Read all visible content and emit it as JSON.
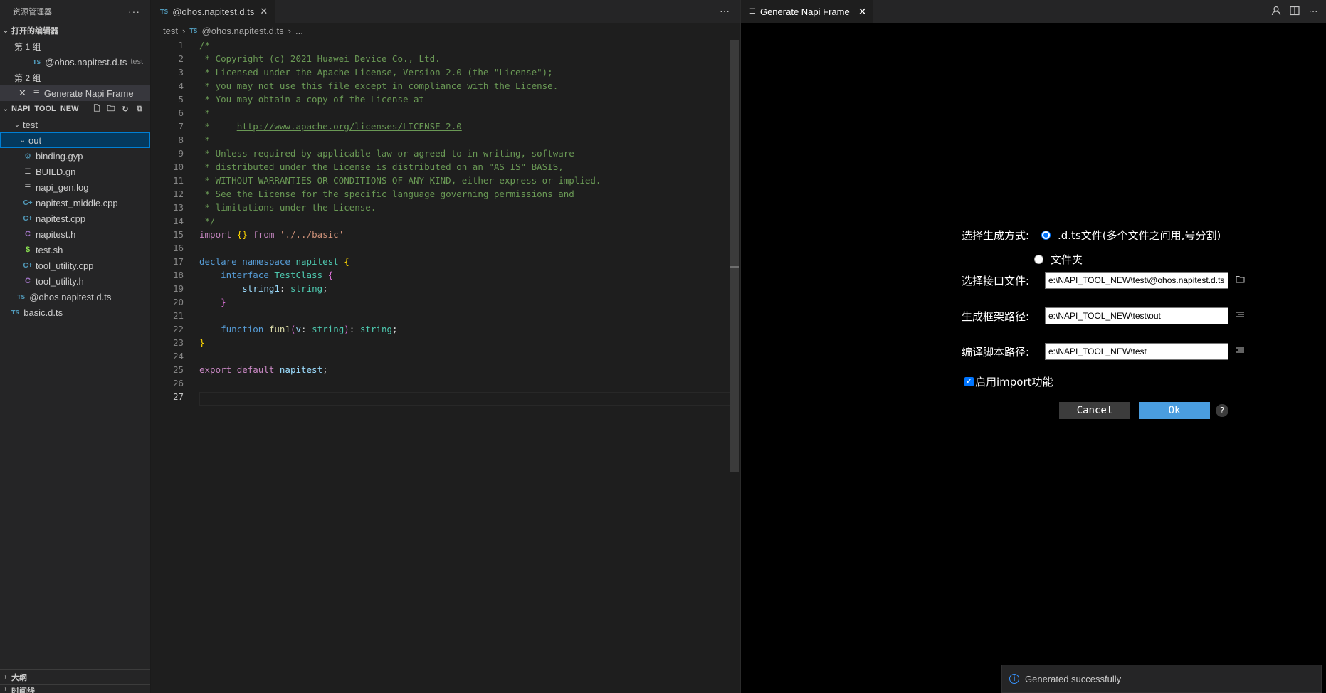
{
  "explorer": {
    "title": "资源管理器",
    "more": "···",
    "open_editors": {
      "label": "打开的编辑器",
      "group1": "第 1 组",
      "group1_file": "@ohos.napitest.d.ts",
      "group1_file_desc": "test",
      "group2": "第 2 组",
      "group2_file": "Generate Napi Frame"
    },
    "project": {
      "label": "NAPI_TOOL_NEW",
      "folder_test": "test",
      "folder_out": "out",
      "files_out": [
        {
          "name": "binding.gyp",
          "icon": "gyp-icon"
        },
        {
          "name": "BUILD.gn",
          "icon": "lines-icon"
        },
        {
          "name": "napi_gen.log",
          "icon": "lines-icon"
        },
        {
          "name": "napitest_middle.cpp",
          "icon": "cpp-icon"
        },
        {
          "name": "napitest.cpp",
          "icon": "cpp-icon"
        },
        {
          "name": "napitest.h",
          "icon": "h-icon"
        },
        {
          "name": "test.sh",
          "icon": "sh-icon"
        },
        {
          "name": "tool_utility.cpp",
          "icon": "cpp-icon"
        },
        {
          "name": "tool_utility.h",
          "icon": "h-icon"
        }
      ],
      "file_test_ts": "@ohos.napitest.d.ts",
      "file_root_ts": "basic.d.ts"
    },
    "outline": "大纲",
    "timeline": "时间线"
  },
  "editor": {
    "tab_label": "@ohos.napitest.d.ts",
    "ts_badge": "TS",
    "breadcrumb": {
      "folder": "test",
      "file": "@ohos.napitest.d.ts",
      "more": "..."
    },
    "current_line": 27
  },
  "panel": {
    "tab_label": "Generate Napi Frame",
    "form": {
      "mode_label": "选择生成方式:",
      "mode_option1": ".d.ts文件(多个文件之间用,号分割)",
      "mode_option2": "文件夹",
      "interface_label": "选择接口文件:",
      "interface_value": "e:\\NAPI_TOOL_NEW\\test\\@ohos.napitest.d.ts",
      "output_label": "生成框架路径:",
      "output_value": "e:\\NAPI_TOOL_NEW\\test\\out",
      "script_label": "编译脚本路径:",
      "script_value": "e:\\NAPI_TOOL_NEW\\test",
      "import_label": "启用import功能",
      "cancel": "Cancel",
      "ok": "Ok",
      "help": "?"
    },
    "toast": "Generated successfully"
  },
  "colors": {
    "accent": "#007fd4",
    "ok_button": "#4a9ddf",
    "comment": "#6a9955"
  }
}
